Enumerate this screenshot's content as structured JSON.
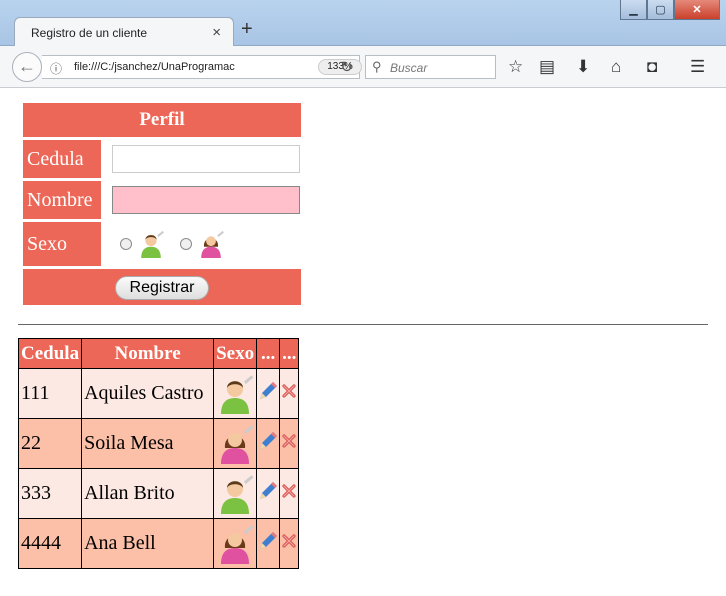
{
  "browser": {
    "tab_title": "Registro de un cliente",
    "tab_close": "×",
    "new_tab": "+",
    "url": "file:///C:/jsanchez/UnaProgramac",
    "zoom": "133%",
    "search_placeholder": "Buscar",
    "window": {
      "minimize": "▁",
      "maximize": "▢",
      "close": "✕"
    }
  },
  "form": {
    "title": "Perfil",
    "labels": {
      "cedula": "Cedula",
      "nombre": "Nombre",
      "sexo": "Sexo"
    },
    "values": {
      "cedula": "",
      "nombre": ""
    },
    "submit_label": "Registrar"
  },
  "table": {
    "headers": [
      "Cedula",
      "Nombre",
      "Sexo",
      "...",
      "..."
    ],
    "rows": [
      {
        "cedula": "111",
        "nombre": "Aquiles Castro",
        "sexo": "male"
      },
      {
        "cedula": "22",
        "nombre": "Soila Mesa",
        "sexo": "female"
      },
      {
        "cedula": "333",
        "nombre": "Allan Brito",
        "sexo": "male"
      },
      {
        "cedula": "4444",
        "nombre": "Ana Bell",
        "sexo": "female"
      }
    ]
  },
  "colors": {
    "accent": "#ec6757",
    "row_light": "#fde9e4",
    "row_dark": "#fcbfa7",
    "nombre_field": "#ffc0cb"
  },
  "icons": [
    "back-arrow-icon",
    "info-icon",
    "reload-icon",
    "search-icon",
    "bookmark-star-icon",
    "reading-list-icon",
    "download-icon",
    "home-icon",
    "pocket-icon",
    "menu-icon",
    "male-user-icon",
    "female-user-icon",
    "edit-pencil-icon",
    "delete-x-icon"
  ]
}
